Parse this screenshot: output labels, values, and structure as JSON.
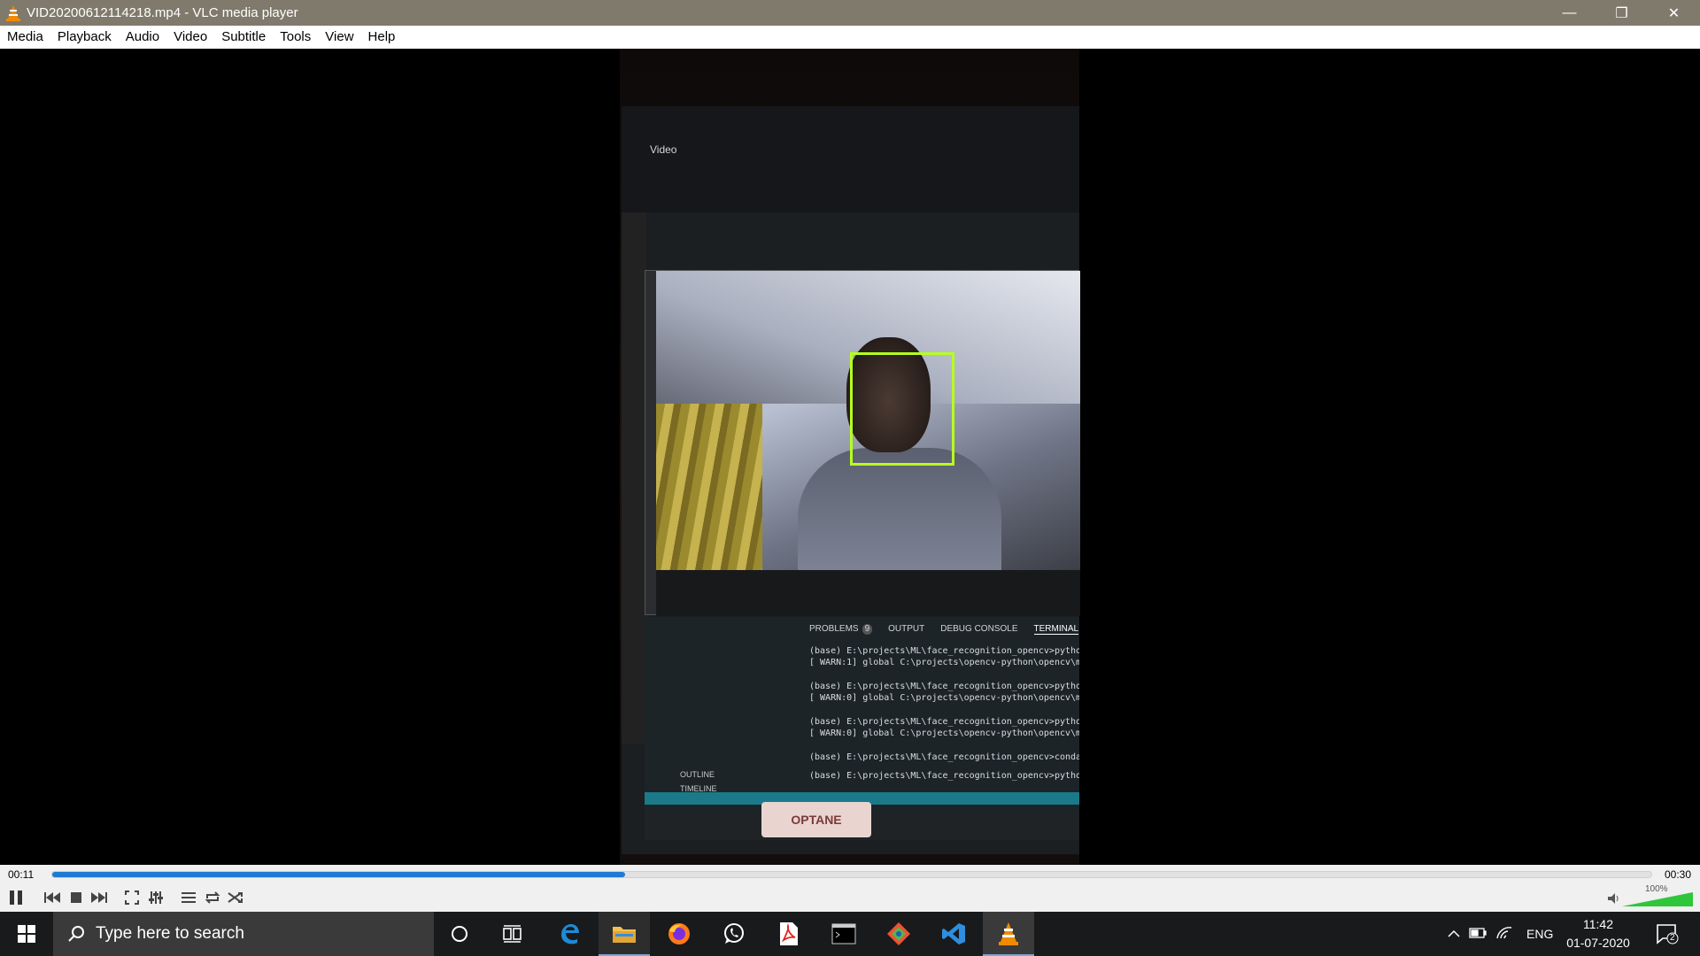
{
  "window": {
    "title": "VID20200612114218.mp4 - VLC media player",
    "minimize": "—",
    "maximize": "❐",
    "close": "✕"
  },
  "menu": [
    "Media",
    "Playback",
    "Audio",
    "Video",
    "Subtitle",
    "Tools",
    "View",
    "Help"
  ],
  "video_content": {
    "window_label": "Video",
    "panel_tabs": [
      "PROBLEMS",
      "OUTPUT",
      "DEBUG CONSOLE",
      "TERMINAL"
    ],
    "problems_count": "9",
    "terminal_lines": [
      "(base) E:\\projects\\ML\\face_recognition_opencv>pytho",
      "[ WARN:1] global C:\\projects\\opencv-python\\opencv\\m",
      "(base) E:\\projects\\ML\\face_recognition_opencv>pytho",
      "[ WARN:0] global C:\\projects\\opencv-python\\opencv\\m",
      "(base) E:\\projects\\ML\\face_recognition_opencv>pytho",
      "[ WARN:0] global C:\\projects\\opencv-python\\opencv\\m",
      "(base) E:\\projects\\ML\\face_recognition_opencv>conda",
      "(base) E:\\projects\\ML\\face_recognition_opencv>python"
    ],
    "outline_items": [
      "OUTLINE",
      "TIMELINE"
    ],
    "optane_label": "OPTANE"
  },
  "playback": {
    "elapsed": "00:11",
    "total": "00:30",
    "progress": 0.358,
    "volume": "100%",
    "volume_level": 1.0
  },
  "controls": [
    {
      "name": "pause-button",
      "icon": "pause-icon"
    },
    {
      "name": "previous-button",
      "icon": "skip-previous-icon"
    },
    {
      "name": "stop-button",
      "icon": "stop-icon"
    },
    {
      "name": "next-button",
      "icon": "skip-next-icon"
    },
    {
      "name": "fullscreen-button",
      "icon": "fullscreen-icon"
    },
    {
      "name": "extended-settings-button",
      "icon": "sliders-icon"
    },
    {
      "name": "playlist-button",
      "icon": "playlist-icon"
    },
    {
      "name": "loop-button",
      "icon": "loop-icon"
    },
    {
      "name": "shuffle-button",
      "icon": "shuffle-icon"
    }
  ],
  "taskbar": {
    "search_placeholder": "Type here to search",
    "apps": [
      "cortana-icon",
      "task-view-icon",
      "edge-icon",
      "file-explorer-icon",
      "firefox-icon",
      "whatsapp-icon",
      "acrobat-icon",
      "terminal-icon",
      "git-icon",
      "vscode-icon",
      "vlc-icon"
    ],
    "language": "ENG",
    "time": "11:42",
    "date": "01-07-2020",
    "notifications": "2"
  },
  "colors": {
    "titlebar": "#807a6d",
    "seek_fill": "#1f7ad3",
    "face_box": "#b7ff1f",
    "taskbar": "#191a1c"
  }
}
